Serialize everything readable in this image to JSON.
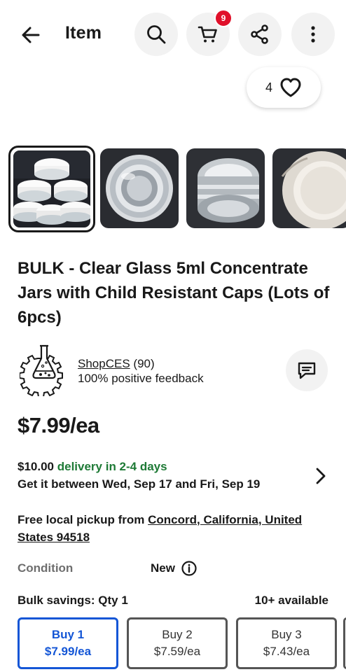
{
  "header": {
    "title": "Item",
    "back_icon": "arrow-left-icon",
    "search_icon": "search-icon",
    "cart_icon": "cart-icon",
    "cart_count": "9",
    "share_icon": "share-icon",
    "more_icon": "more-vertical-icon"
  },
  "watch": {
    "count": "4",
    "icon": "heart-icon"
  },
  "gallery": {
    "thumbnails": [
      "jar-stack-photo",
      "open-jar-top-photo",
      "jar-side-photo",
      "cap-inside-photo"
    ],
    "selected_index": 0
  },
  "item": {
    "title": "BULK - Clear Glass 5ml Concentrate Jars with Child Resistant Caps (Lots of 6pcs)",
    "price": "$7.99/ea"
  },
  "seller": {
    "name": "ShopCES",
    "rating_count": "(90)",
    "feedback": "100% positive feedback",
    "message_icon": "message-icon"
  },
  "shipping": {
    "cost": "$10.00",
    "delivery": "delivery in 2-4 days",
    "dates": "Get it between Wed, Sep 17 and Fri, Sep 19"
  },
  "pickup": {
    "prefix": "Free local pickup from",
    "location": "Concord, California, United States 94518"
  },
  "condition": {
    "label": "Condition",
    "value": "New"
  },
  "bulk": {
    "label": "Bulk savings: Qty 1",
    "available": "10+ available",
    "options": [
      {
        "qty": "Buy 1",
        "price": "$7.99/ea",
        "selected": true
      },
      {
        "qty": "Buy 2",
        "price": "$7.59/ea",
        "selected": false
      },
      {
        "qty": "Buy 3",
        "price": "$7.43/ea",
        "selected": false
      }
    ]
  },
  "colors": {
    "brand_blue": "#1456d6",
    "delivery_green": "#1e7a36",
    "badge_red": "#e0102a"
  }
}
